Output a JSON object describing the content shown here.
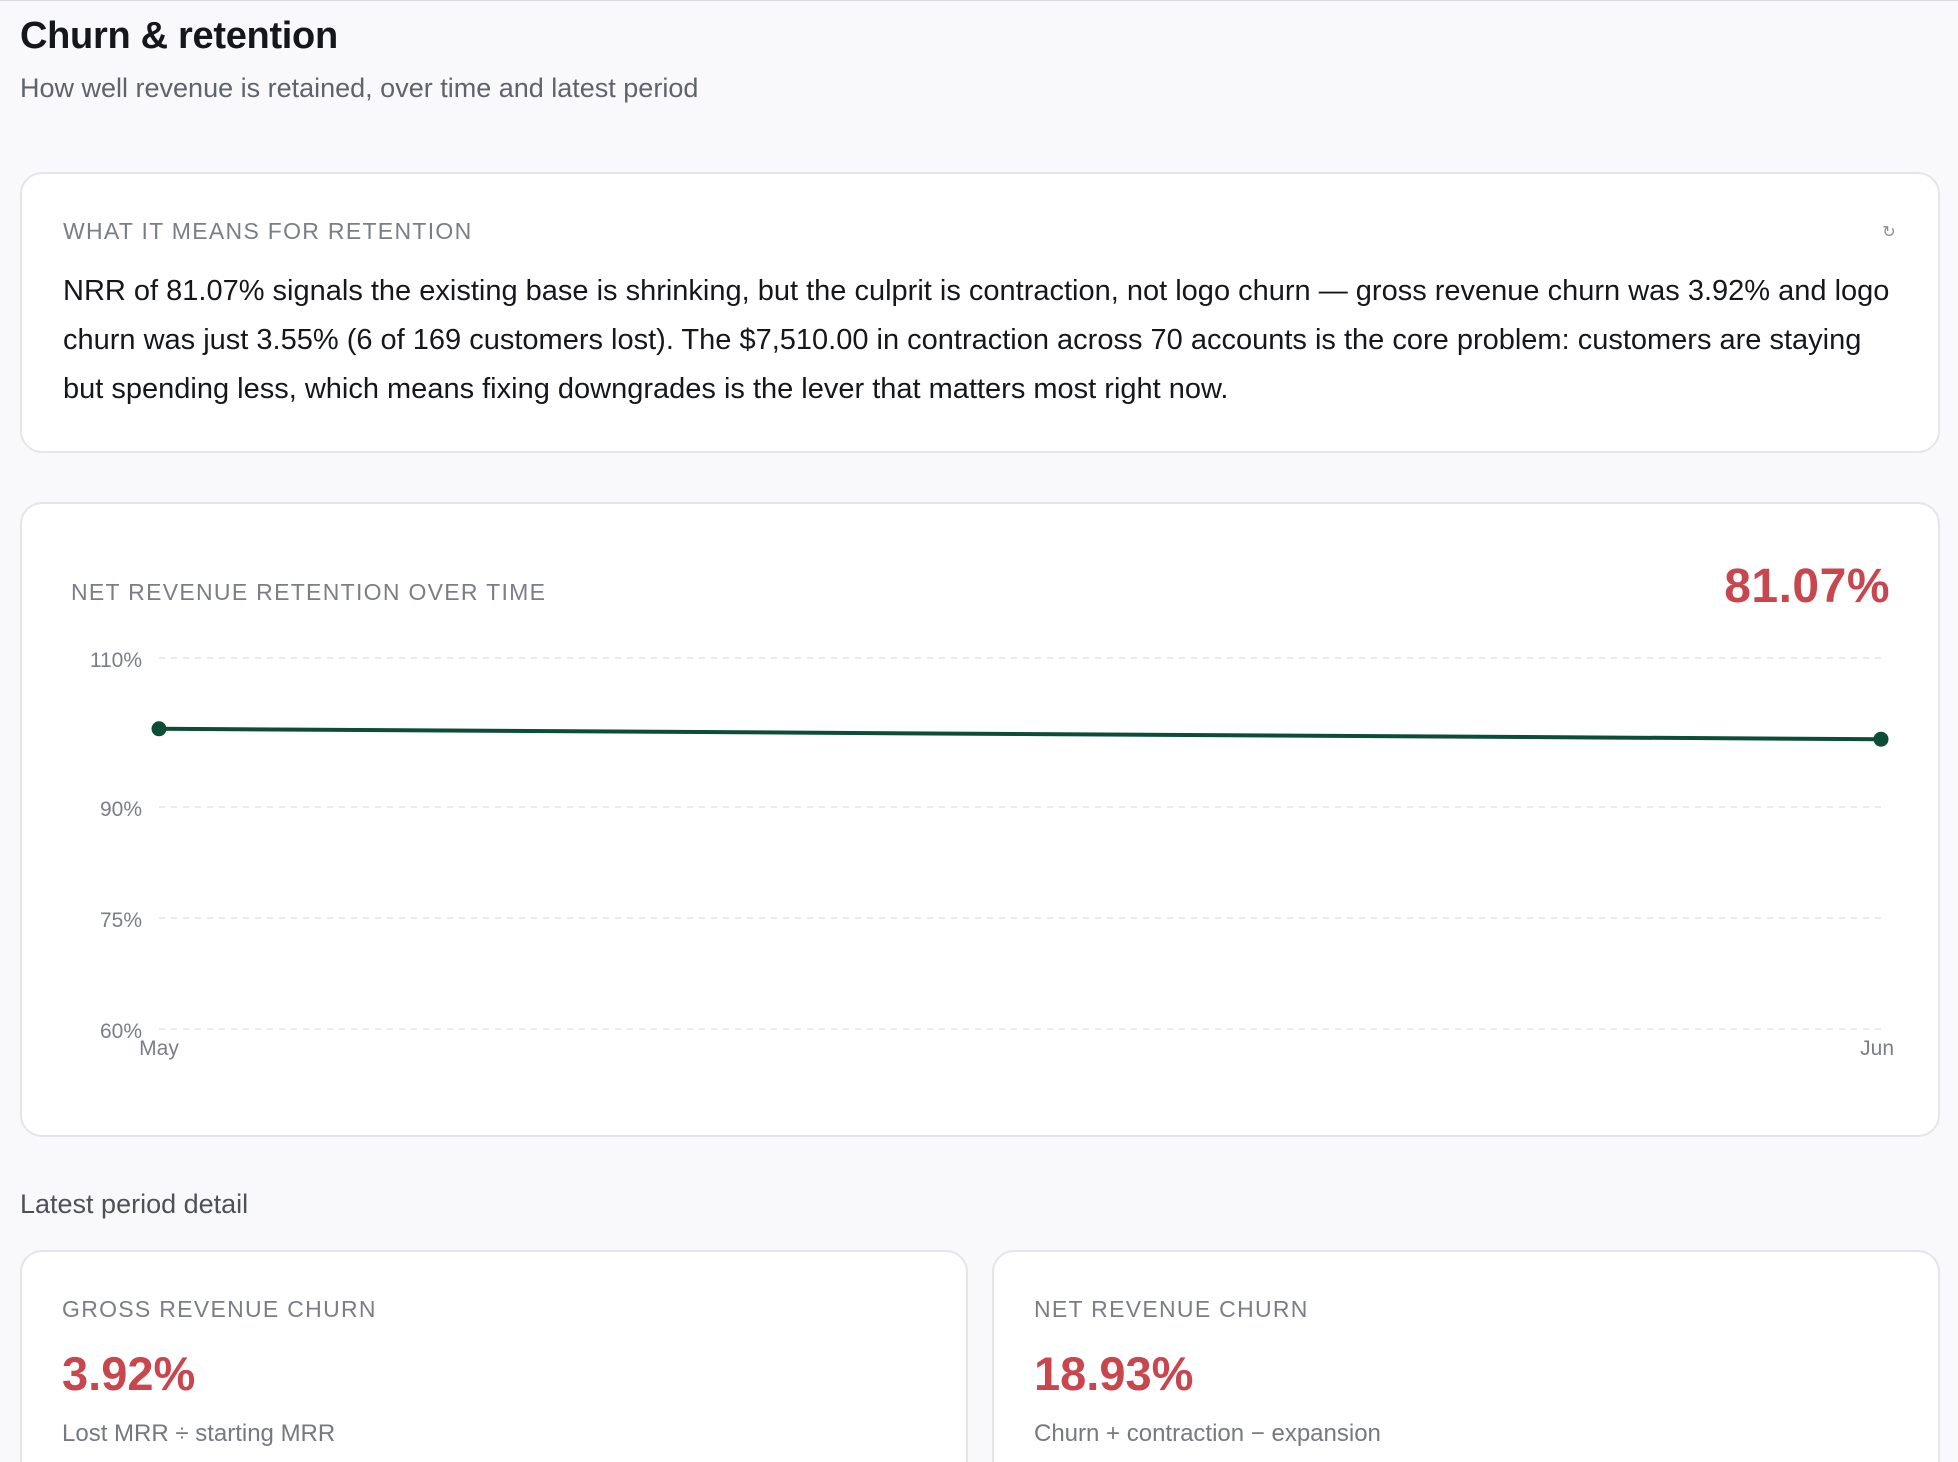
{
  "header": {
    "title": "Churn & retention",
    "subtitle": "How well revenue is retained, over time and latest period"
  },
  "insight": {
    "label": "WHAT IT MEANS FOR RETENTION",
    "refresh_icon": "↻",
    "text": "NRR of 81.07% signals the existing base is shrinking, but the culprit is contraction, not logo churn — gross revenue churn was 3.92% and logo churn was just 3.55% (6 of 169 customers lost). The $7,510.00 in contraction across 70 accounts is the core problem: customers are staying but spending less, which means fixing downgrades is the lever that matters most right now."
  },
  "nrr_chart": {
    "label": "NET REVENUE RETENTION OVER TIME",
    "current_value": "81.07%"
  },
  "chart_data": {
    "type": "line",
    "categories": [
      "May",
      "Jun"
    ],
    "series": [
      {
        "values": [
          100.5,
          99.1
        ]
      }
    ],
    "y_ticks": [
      60,
      75,
      90,
      110
    ],
    "y_tick_labels": [
      "60%",
      "75%",
      "90%",
      "110%"
    ],
    "ylim": [
      60,
      110
    ],
    "grid": true,
    "colors": {
      "line": "#0c4d36",
      "grid": "#e2e3e7",
      "tick_label": "#7a7e87"
    }
  },
  "latest_period": {
    "heading": "Latest period detail",
    "metrics": [
      {
        "label": "GROSS REVENUE CHURN",
        "value": "3.92%",
        "description": "Lost MRR ÷ starting MRR"
      },
      {
        "label": "NET REVENUE CHURN",
        "value": "18.93%",
        "description": "Churn + contraction − expansion"
      }
    ]
  },
  "colors": {
    "accent_negative": "#c8474f",
    "card_border": "#e4e5ea",
    "background": "#f9f9fb"
  }
}
